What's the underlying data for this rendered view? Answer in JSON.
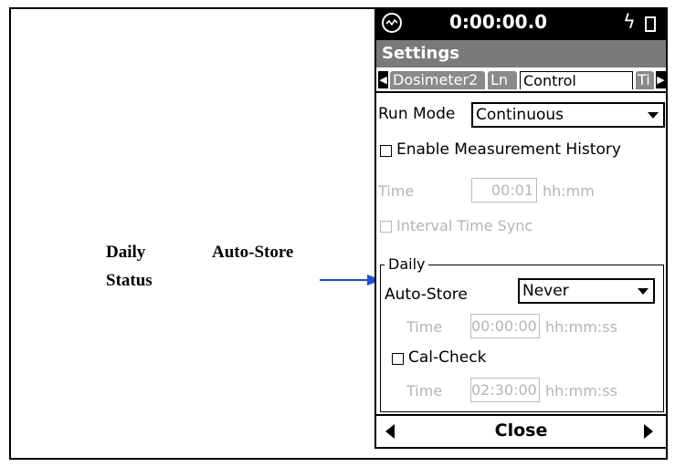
{
  "callouts": {
    "line1_left": "Daily",
    "line1_right": "Auto-Store",
    "line2": "Status"
  },
  "device": {
    "clock": "0:00:00.0",
    "title": "Settings",
    "tabs": [
      {
        "label": "Dosimeter2",
        "active": false
      },
      {
        "label": "Ln",
        "active": false
      },
      {
        "label": "Control",
        "active": true
      },
      {
        "label": "Ti",
        "active": false
      }
    ],
    "run_mode": {
      "label": "Run Mode",
      "value": "Continuous"
    },
    "enable_history": {
      "label": "Enable Measurement History",
      "checked": false
    },
    "history_time": {
      "label": "Time",
      "value": "00:01",
      "unit": "hh:mm"
    },
    "interval_sync": {
      "label": "Interval Time Sync",
      "checked": false
    },
    "daily": {
      "legend": "Daily",
      "auto_store": {
        "label": "Auto-Store",
        "value": "Never"
      },
      "auto_store_time": {
        "label": "Time",
        "value": "00:00:00",
        "unit": "hh:mm:ss"
      },
      "cal_check": {
        "label": "Cal-Check",
        "checked": false
      },
      "cal_check_time": {
        "label": "Time",
        "value": "02:30:00",
        "unit": "hh:mm:ss"
      }
    },
    "bottom": {
      "close_label": "Close"
    }
  },
  "colors": {
    "arrow": "#1f4fd6",
    "title_bar": "#7a7a7a",
    "disabled_text": "#b5b5b5"
  },
  "icons": [
    "meter-logo-icon",
    "lightning-icon",
    "battery-icon",
    "chevron-left-icon",
    "chevron-right-icon",
    "dropdown-caret-icon",
    "arrow-right-icon"
  ]
}
